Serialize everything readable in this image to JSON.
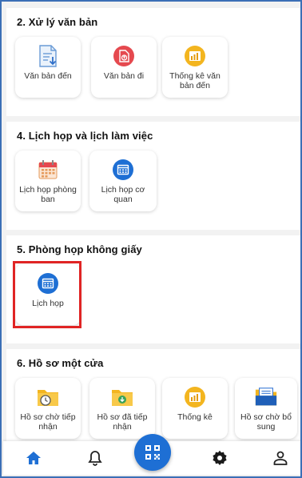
{
  "sections": [
    {
      "title": "2. Xử lý văn bản",
      "items": [
        {
          "label": "Văn bản đến",
          "icon": "incoming-document-icon"
        },
        {
          "label": "Văn bản đi",
          "icon": "outgoing-document-icon"
        },
        {
          "label": "Thống kê văn bản đến",
          "icon": "statistics-chart-icon"
        }
      ]
    },
    {
      "title": "4. Lịch họp và lịch làm việc",
      "items": [
        {
          "label": "Lịch họp phòng ban",
          "icon": "calendar-icon"
        },
        {
          "label": "Lịch họp cơ quan",
          "icon": "calendar-circle-icon"
        }
      ]
    },
    {
      "title": "5. Phòng họp không giấy",
      "items": [
        {
          "label": "Lịch họp",
          "icon": "calendar-circle-icon",
          "highlighted": true
        }
      ]
    },
    {
      "title": "6. Hồ sơ một cửa",
      "items": [
        {
          "label": "Hồ sơ chờ tiếp nhận",
          "icon": "folder-clock-icon"
        },
        {
          "label": "Hồ sơ đã tiếp nhận",
          "icon": "folder-download-icon"
        },
        {
          "label": "Thống kê",
          "icon": "statistics-chart-icon"
        },
        {
          "label": "Hồ sơ chờ bổ sung",
          "icon": "folder-documents-icon"
        }
      ]
    }
  ],
  "bottom_nav": {
    "items": [
      "home-icon",
      "bell-icon",
      "qr-code-icon",
      "gear-icon",
      "user-icon"
    ],
    "active": "home-icon"
  },
  "colors": {
    "frame_border": "#3b6fb6",
    "accent_blue": "#1e6fd4",
    "highlight_red": "#e02424",
    "icon_red": "#e5494f",
    "icon_yellow": "#f3b51f"
  }
}
